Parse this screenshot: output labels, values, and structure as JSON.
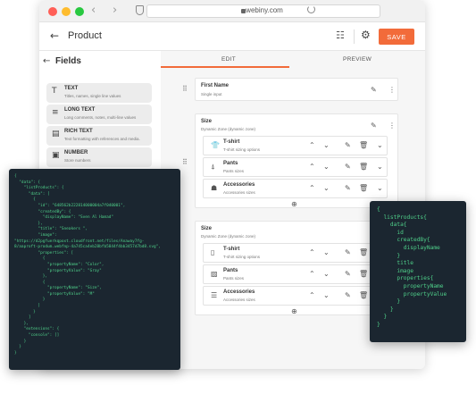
{
  "browser": {
    "url": "webiny.com",
    "traffic_colors": [
      "#ff5f57",
      "#febc2e",
      "#28c840"
    ]
  },
  "header": {
    "title": "Product",
    "save_label": "SAVE",
    "accent": "#f26b3a"
  },
  "sidebar": {
    "title": "Fields",
    "items": [
      {
        "icon": "text-icon",
        "glyph": "T",
        "title": "TEXT",
        "sub": "Titles, names, single line values"
      },
      {
        "icon": "long-text-icon",
        "glyph": "≡",
        "title": "LONG TEXT",
        "sub": "Long comments, notes, multi-line values"
      },
      {
        "icon": "rich-text-icon",
        "glyph": "▤",
        "title": "RICH TEXT",
        "sub": "Text formatting with references and media."
      },
      {
        "icon": "number-icon",
        "glyph": "▣",
        "title": "NUMBER",
        "sub": "Store numbers"
      }
    ]
  },
  "tabs": {
    "edit": "EDIT",
    "preview": "PREVIEW"
  },
  "first_name": {
    "title": "First Name",
    "sub": "Single input"
  },
  "size_zone_1": {
    "title": "Size",
    "sub": "Dynamic Zone (dynamic zone)",
    "rows": [
      {
        "icon": "tshirt-icon",
        "glyph": "👕",
        "title": "T-shirt",
        "sub": "T-shirt sizing options"
      },
      {
        "icon": "pants-icon",
        "glyph": "⍋",
        "title": "Pants",
        "sub": "Pants sizes"
      },
      {
        "icon": "accessories-icon",
        "glyph": "☗",
        "title": "Accessories",
        "sub": "Accessories sizes"
      }
    ]
  },
  "size_zone_2": {
    "title": "Size",
    "sub": "Dynamic Zone (dynamic zone)",
    "rows": [
      {
        "icon": "file-icon",
        "glyph": "▯",
        "title": "T-shirt",
        "sub": "T-shirt sizing options"
      },
      {
        "icon": "gallery-icon",
        "glyph": "▨",
        "title": "Pants",
        "sub": "Pants sizes"
      },
      {
        "icon": "list-icon",
        "glyph": "☰",
        "title": "Accessories",
        "sub": "Accessories sizes"
      }
    ]
  },
  "json_code": "{\n  \"data\": {\n    \"listProducts\": {\n      \"data\": [\n        {\n          \"id\": \"648562b222814000004a7f040001\",\n          \"createdBy\": {\n            \"displayName\": \"Sven Al Hamad\"\n          },\n          \"title\": \"Sneakers \",\n          \"image\":\n\"https://d2pgfuerkqpoxt.cloudfront.net/files/Anaway7fg-\n8/aaproft-produm.webfnp-4a745ca4eb28bfb5844f4bb3457d7bd8.svg\",\n          \"properties\": [\n            {\n              \"propertyName\": \"Color\",\n              \"propertyValue\": \"Gray\"\n            },\n            {\n              \"propertyName\": \"Size\",\n              \"propertyValue\": \"M\"\n            }\n          ]\n        }\n      ]\n    },\n    \"extensions\": {\n      \"console\": []\n    }\n  }\n}",
  "graphql_code": "{\n  listProducts{\n    data{\n      id\n      createdBy{\n        displayName\n      }\n      title\n      image\n      properties{\n        propertyName\n        propertyValue\n      }\n    }\n  }\n}"
}
